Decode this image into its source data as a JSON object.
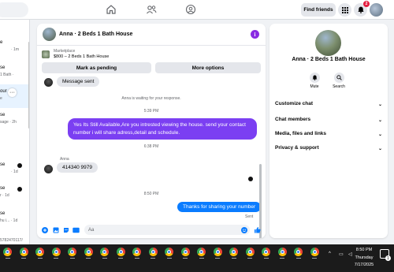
{
  "topbar": {
    "find_friends": "Find friends",
    "notification_count": "2"
  },
  "left_list": {
    "rows": [
      {
        "t1": "e",
        "t2": "· 1m"
      },
      {
        "t1": "se",
        "t2": "1 Bath ·"
      },
      {
        "t1": "our",
        "t2": "e"
      },
      {
        "t1": "se",
        "t2": "sage · 2h"
      },
      {
        "t1": "se",
        "t2": "· 1d"
      },
      {
        "t1": "se",
        "t2": "r · 1d"
      },
      {
        "t1": "se",
        "t2": "hu i... · 1d"
      }
    ],
    "more": "···",
    "footer_id": "5782470117/"
  },
  "chat": {
    "title": "Anna · 2 Beds 1 Bath House",
    "info_icon": "i",
    "marketplace_label": "Marketplace",
    "listing": "$800 – 2 Beds 1 Bath House",
    "mark_pending": "Mark as pending",
    "more_options": "More options",
    "messages": {
      "msg1": "Message sent",
      "system": "Anna is waiting for your response.",
      "ts1": "5:39 PM",
      "purple": "Yes Its Still Available,Are you intrested viewing the house. send your contact number i will share adress,detail and schedule.",
      "ts2": "6:38 PM",
      "sender": "Anna",
      "phone": "414340 9979",
      "ts3": "8:50 PM",
      "blue": "Thanks for sharing your number",
      "sent": "Sent"
    },
    "composer_placeholder": "Aa"
  },
  "info": {
    "title": "Anna · 2 Beds 1 Bath House",
    "mute": "Mute",
    "search": "Search",
    "sections": [
      "Customize chat",
      "Chat members",
      "Media, files and links",
      "Privacy & support"
    ]
  },
  "taskbar": {
    "time": "8:50 PM",
    "day": "Thursday",
    "date": "7/17/2025",
    "notify_count": "1"
  },
  "colors": {
    "brand_purple": "#7b3ff2",
    "messenger_blue": "#0a7cff",
    "taskbar": "#1b1b1b"
  }
}
